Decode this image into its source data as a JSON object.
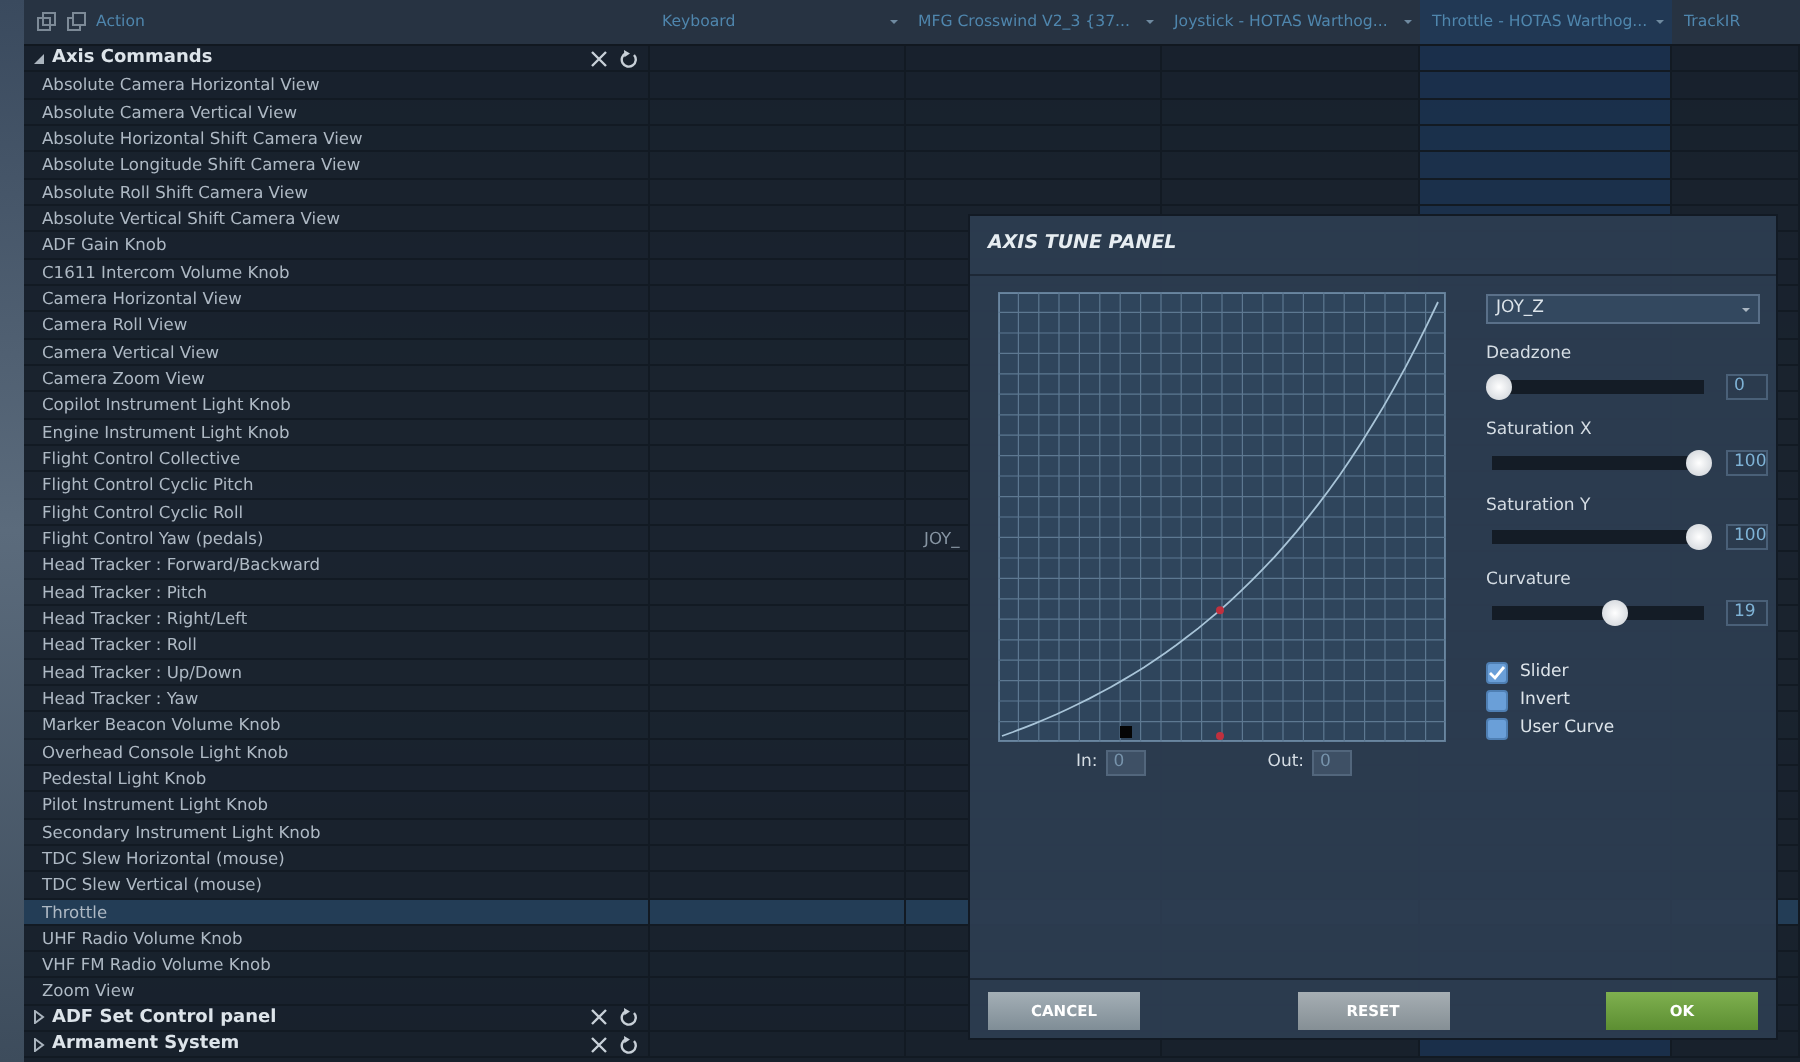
{
  "table": {
    "columns": [
      {
        "label": "Action",
        "dropdown": false,
        "selected": false
      },
      {
        "label": "Keyboard",
        "dropdown": true,
        "selected": false
      },
      {
        "label": "MFG Crosswind V2_3 {37...",
        "dropdown": true,
        "selected": false
      },
      {
        "label": "Joystick - HOTAS Warthog...",
        "dropdown": true,
        "selected": false
      },
      {
        "label": "Throttle - HOTAS Warthog...",
        "dropdown": true,
        "selected": true
      },
      {
        "label": "TrackIR",
        "dropdown": false,
        "selected": false
      }
    ],
    "groups": [
      {
        "title": "Axis Commands",
        "expanded": true,
        "items": [
          {
            "label": "Absolute Camera Horizontal View",
            "selected": false
          },
          {
            "label": "Absolute Camera Vertical View",
            "selected": false
          },
          {
            "label": "Absolute Horizontal Shift Camera View",
            "selected": false
          },
          {
            "label": "Absolute Longitude Shift Camera View",
            "selected": false
          },
          {
            "label": "Absolute Roll Shift Camera View",
            "selected": false
          },
          {
            "label": "Absolute Vertical Shift Camera View",
            "selected": false
          },
          {
            "label": "ADF Gain Knob",
            "selected": false
          },
          {
            "label": "C1611 Intercom Volume Knob",
            "selected": false
          },
          {
            "label": "Camera Horizontal View",
            "selected": false
          },
          {
            "label": "Camera Roll View",
            "selected": false
          },
          {
            "label": "Camera Vertical View",
            "selected": false
          },
          {
            "label": "Camera Zoom View",
            "selected": false
          },
          {
            "label": "Copilot Instrument Light Knob",
            "selected": false
          },
          {
            "label": "Engine Instrument Light Knob",
            "selected": false
          },
          {
            "label": "Flight Control Collective",
            "selected": false
          },
          {
            "label": "Flight Control Cyclic Pitch",
            "selected": false
          },
          {
            "label": "Flight Control Cyclic Roll",
            "selected": false
          },
          {
            "label": "Flight Control Yaw (pedals)",
            "selected": false,
            "mfg_binding": "JOY_"
          },
          {
            "label": "Head Tracker : Forward/Backward",
            "selected": false
          },
          {
            "label": "Head Tracker : Pitch",
            "selected": false
          },
          {
            "label": "Head Tracker : Right/Left",
            "selected": false
          },
          {
            "label": "Head Tracker : Roll",
            "selected": false
          },
          {
            "label": "Head Tracker : Up/Down",
            "selected": false
          },
          {
            "label": "Head Tracker : Yaw",
            "selected": false
          },
          {
            "label": "Marker Beacon Volume Knob",
            "selected": false
          },
          {
            "label": "Overhead Console Light Knob",
            "selected": false
          },
          {
            "label": "Pedestal Light Knob",
            "selected": false
          },
          {
            "label": "Pilot Instrument Light Knob",
            "selected": false
          },
          {
            "label": "Secondary Instrument Light Knob",
            "selected": false
          },
          {
            "label": "TDC Slew Horizontal (mouse)",
            "selected": false
          },
          {
            "label": "TDC Slew Vertical (mouse)",
            "selected": false
          },
          {
            "label": "Throttle",
            "selected": true
          },
          {
            "label": "UHF Radio Volume Knob",
            "selected": false
          },
          {
            "label": "VHF FM Radio Volume Knob",
            "selected": false
          },
          {
            "label": "Zoom View",
            "selected": false
          }
        ]
      },
      {
        "title": "ADF Set Control panel",
        "expanded": false
      },
      {
        "title": "Armament System",
        "expanded": false
      }
    ]
  },
  "dialog": {
    "title": "AXIS TUNE PANEL",
    "axis": "JOY_Z",
    "sliders": [
      {
        "label": "Deadzone",
        "level": 0,
        "value": "0"
      },
      {
        "label": "Saturation X",
        "level": 1,
        "value": "100"
      },
      {
        "label": "Saturation Y",
        "level": 1,
        "value": "100"
      },
      {
        "label": "Curvature",
        "level": 0.58,
        "value": "19"
      }
    ],
    "checkboxes": [
      {
        "label": "Slider",
        "checked": true
      },
      {
        "label": "Invert",
        "checked": false
      },
      {
        "label": "User Curve",
        "checked": false
      }
    ],
    "in_label": "In:",
    "in_value": "0",
    "out_label": "Out:",
    "out_value": "0",
    "buttons": [
      {
        "label": "CANCEL",
        "kind": "cancel"
      },
      {
        "label": "RESET",
        "kind": "reset"
      },
      {
        "label": "OK",
        "kind": "ok"
      }
    ]
  }
}
